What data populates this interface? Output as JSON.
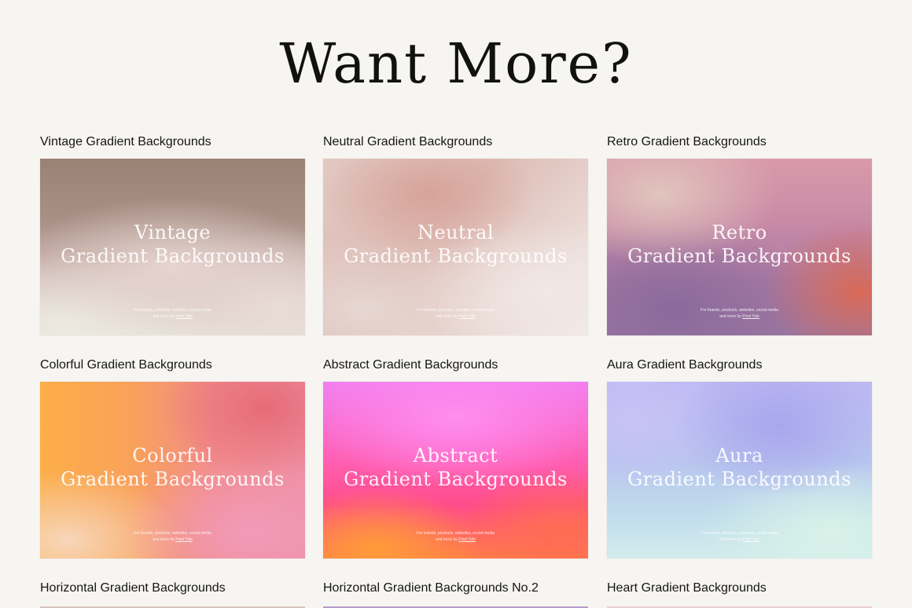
{
  "page_title": "Want More?",
  "colors": {
    "background": "#f7f5f2",
    "title_text": "#111111",
    "card_overlay_text": "#ffffff"
  },
  "products": [
    {
      "title": "Vintage Gradient Backgrounds",
      "overlay_line1": "Vintage",
      "overlay_line2": "Gradient Backgrounds",
      "note_line1": "For brands, products, websites, social media",
      "note_line2_prefix": "and more by ",
      "note_link": "Pixel Tide"
    },
    {
      "title": "Neutral Gradient Backgrounds",
      "overlay_line1": "Neutral",
      "overlay_line2": "Gradient Backgrounds",
      "note_line1": "For brands, products, websites, social media",
      "note_line2_prefix": "and more by ",
      "note_link": "Pixel Tide"
    },
    {
      "title": "Retro Gradient Backgrounds",
      "overlay_line1": "Retro",
      "overlay_line2": "Gradient Backgrounds",
      "note_line1": "For brands, products, websites, social media",
      "note_line2_prefix": "and more by ",
      "note_link": "Pixel Tide"
    },
    {
      "title": "Colorful Gradient Backgrounds",
      "overlay_line1": "Colorful",
      "overlay_line2": "Gradient Backgrounds",
      "note_line1": "For brands, products, websites, social media",
      "note_line2_prefix": "and more by ",
      "note_link": "Pixel Tide"
    },
    {
      "title": "Abstract Gradient Backgrounds",
      "overlay_line1": "Abstract",
      "overlay_line2": "Gradient Backgrounds",
      "note_line1": "For brands, products, websites, social media",
      "note_line2_prefix": "and more by ",
      "note_link": "Pixel Tide"
    },
    {
      "title": "Aura Gradient Backgrounds",
      "overlay_line1": "Aura",
      "overlay_line2": "Gradient Backgrounds",
      "note_line1": "For brands, products, websites, social media",
      "note_line2_prefix": "and more by ",
      "note_link": "Pixel Tide"
    },
    {
      "title": "Horizontal Gradient Backgrounds"
    },
    {
      "title": "Horizontal Gradient Backgrounds No.2"
    },
    {
      "title": "Heart Gradient Backgrounds"
    }
  ]
}
